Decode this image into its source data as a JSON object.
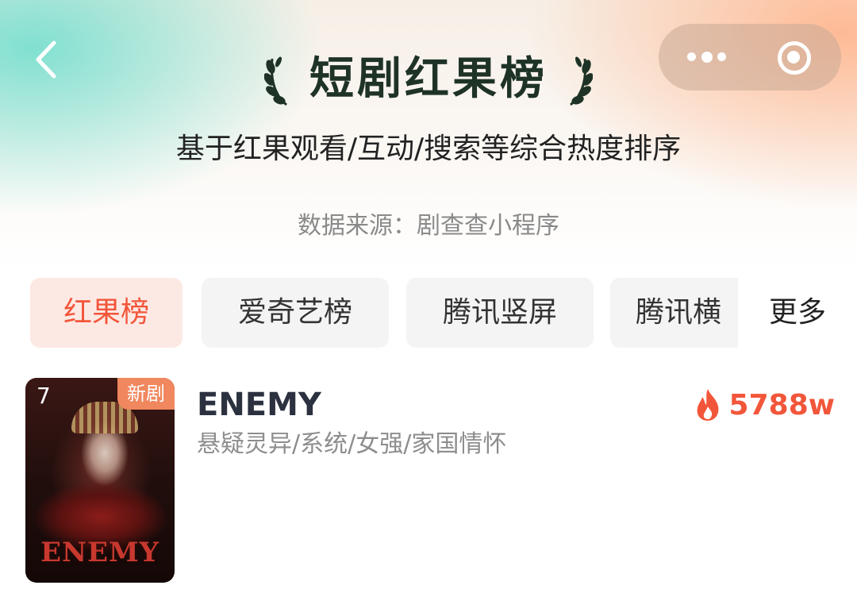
{
  "header": {
    "title": "短剧红果榜",
    "subtitle": "基于红果观看/互动/搜索等综合热度排序",
    "source": "数据来源：剧查查小程序"
  },
  "colors": {
    "accent": "#f2563a",
    "title": "#1e3326",
    "active_tab_bg": "#fde9e4"
  },
  "tabs": [
    {
      "label": "红果榜",
      "active": true
    },
    {
      "label": "爱奇艺榜",
      "active": false
    },
    {
      "label": "腾讯竖屏",
      "active": false
    },
    {
      "label": "腾讯横",
      "active": false
    }
  ],
  "more_label": "更多",
  "items": [
    {
      "rank": "7",
      "badge": "新剧",
      "poster_title": "ENEMY",
      "title": "ENEMY",
      "tags": "悬疑灵异/系统/女强/家国情怀",
      "heat": "5788w",
      "heat_icon": "fire-icon"
    }
  ],
  "icons": {
    "back": "chevron-left-icon",
    "more": "more-dots-icon",
    "close": "target-close-icon",
    "laurel": "laurel-icon"
  }
}
